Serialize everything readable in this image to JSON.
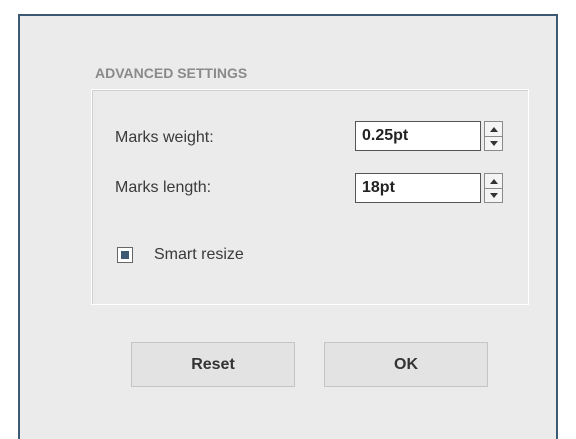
{
  "section": {
    "title": "ADVANCED SETTINGS"
  },
  "fields": [
    {
      "label": "Marks weight:",
      "value": "0.25pt"
    },
    {
      "label": "Marks length:",
      "value": "18pt"
    }
  ],
  "smart_resize": {
    "label": "Smart resize",
    "checked": true
  },
  "buttons": {
    "reset": "Reset",
    "ok": "OK"
  },
  "colors": {
    "accent": "#3d5a74",
    "dialog_bg": "#ebebeb"
  }
}
